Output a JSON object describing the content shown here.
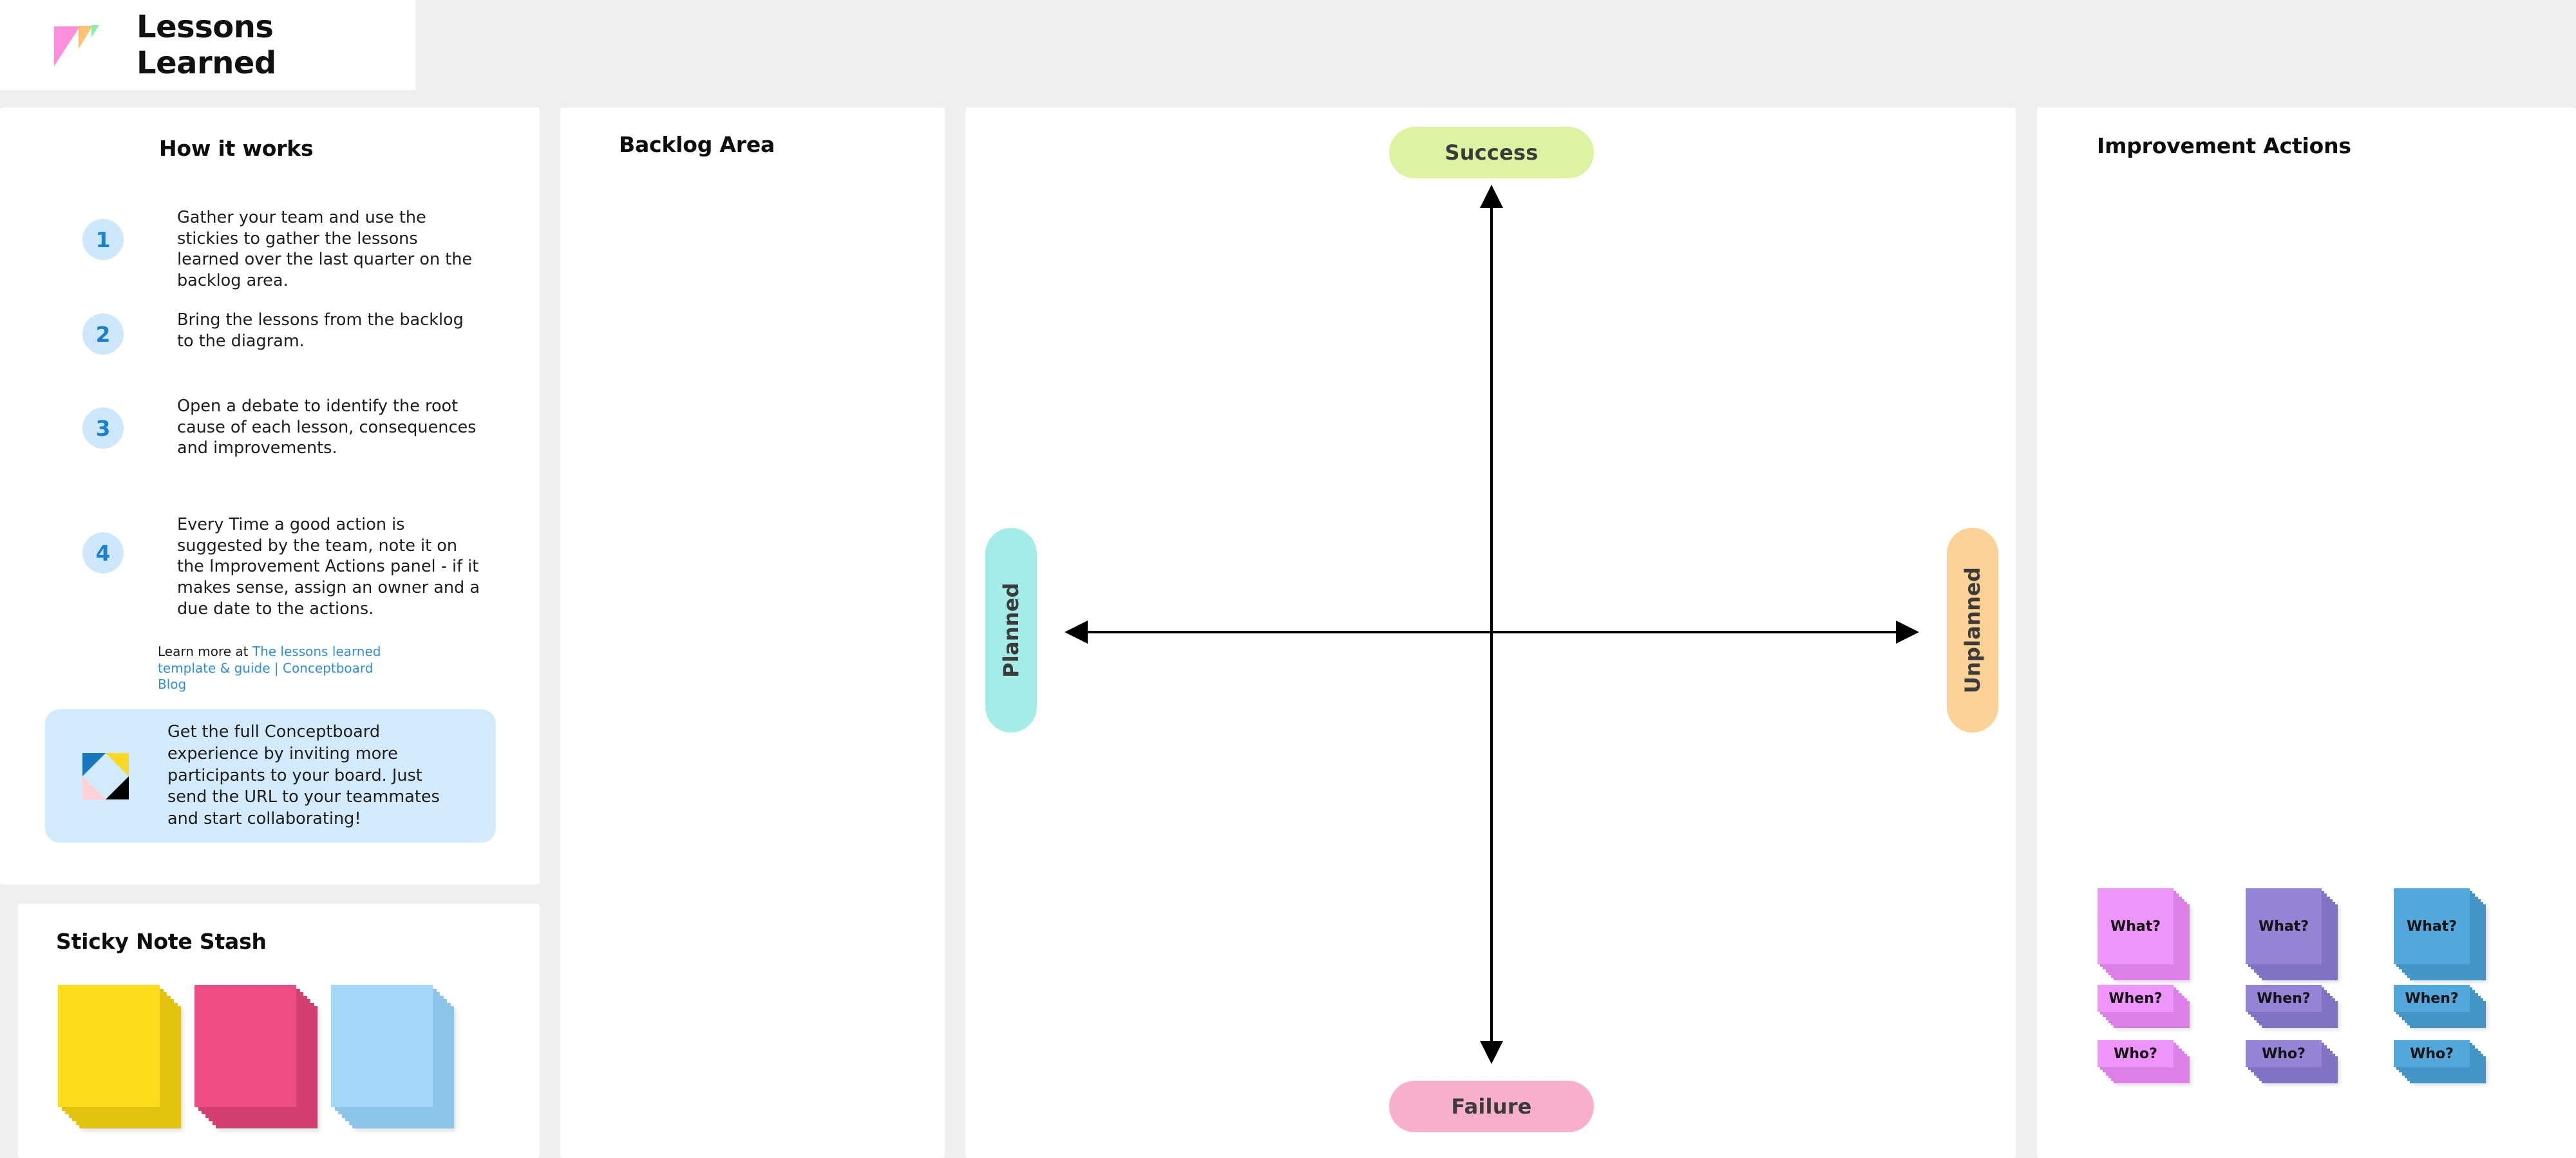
{
  "header": {
    "title": "Lessons Learned",
    "logo_icon": "lessons-learned-logo-icon"
  },
  "instructions": {
    "heading": "How it works",
    "steps": [
      {
        "number": "1",
        "text": "Gather your team and use the stickies to gather the lessons learned over the last quarter on the backlog area."
      },
      {
        "number": "2",
        "text": "Bring the lessons from the backlog to the diagram."
      },
      {
        "number": "3",
        "text": "Open a debate  to identify the root cause of each lesson, consequences and improvements."
      },
      {
        "number": "4",
        "text": "Every Time a good action is suggested by the team, note it on the Improvement Actions panel - if it makes sense, assign an owner and a due date to the actions."
      }
    ],
    "learn_more_prefix": "Learn more at ",
    "learn_more_link": "The lessons learned template & guide | Conceptboard Blog"
  },
  "promo": {
    "logo_icon": "conceptboard-logo-icon",
    "text": "Get the full Conceptboard experience by inviting more participants to your board. Just send the URL to your teammates and start collaborating!",
    "background": "#d3eafd"
  },
  "stash": {
    "heading": "Sticky Note Stash",
    "stacks": [
      {
        "name": "yellow-sticky-stack",
        "color": "#fcdb1c",
        "shade": "#e2c310"
      },
      {
        "name": "pink-sticky-stack",
        "color": "#ee4d84",
        "shade": "#d43f73"
      },
      {
        "name": "blue-sticky-stack",
        "color": "#a5d8f8",
        "shade": "#8dc4e9"
      }
    ]
  },
  "backlog": {
    "heading": "Backlog Area"
  },
  "diagram": {
    "axis_labels": {
      "top": "Success",
      "bottom": "Failure",
      "left": "Planned",
      "right": "Unplanned"
    },
    "colors": {
      "success": "#dcf3a1",
      "failure": "#f9aecb",
      "planned": "#a3ece8",
      "unplanned": "#fcd196",
      "axis": "#000000"
    }
  },
  "improvement": {
    "heading": "Improvement Actions",
    "groups": [
      {
        "name": "improvement-group-magenta",
        "color": "#ef94fa",
        "shade": "#dc7fe8",
        "cards": [
          {
            "label": "What?",
            "size": "large"
          },
          {
            "label": "When?",
            "size": "small"
          },
          {
            "label": "Who?",
            "size": "small"
          }
        ]
      },
      {
        "name": "improvement-group-purple",
        "color": "#9583d8",
        "shade": "#8272c5",
        "cards": [
          {
            "label": "What?",
            "size": "large"
          },
          {
            "label": "When?",
            "size": "small"
          },
          {
            "label": "Who?",
            "size": "small"
          }
        ]
      },
      {
        "name": "improvement-group-blue",
        "color": "#52a8dd",
        "shade": "#4494c7",
        "cards": [
          {
            "label": "What?",
            "size": "large"
          },
          {
            "label": "When?",
            "size": "small"
          },
          {
            "label": "Who?",
            "size": "small"
          }
        ]
      }
    ]
  }
}
